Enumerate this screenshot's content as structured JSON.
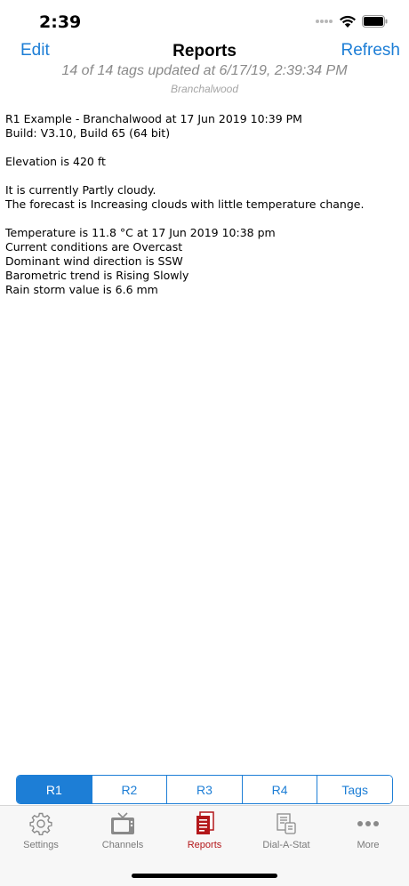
{
  "status_bar": {
    "time": "2:39"
  },
  "nav": {
    "edit_label": "Edit",
    "title": "Reports",
    "refresh_label": "Refresh",
    "subtitle": "14 of 14 tags updated at 6/17/19, 2:39:34 PM",
    "location": "Branchalwood"
  },
  "report": {
    "lines": [
      "R1 Example - Branchalwood at 17 Jun 2019 10:39 PM",
      "Build: V3.10, Build 65 (64 bit)",
      "",
      "Elevation is 420 ft",
      "",
      "It is currently Partly cloudy.",
      "The forecast is Increasing clouds with little temperature change.",
      "",
      "Temperature is 11.8 °C at 17 Jun 2019 10:38 pm",
      "Current conditions are Overcast",
      "Dominant wind direction is SSW",
      "Barometric trend is Rising Slowly",
      "Rain storm value is 6.6 mm"
    ]
  },
  "segments": {
    "items": [
      {
        "label": "R1",
        "selected": true
      },
      {
        "label": "R2",
        "selected": false
      },
      {
        "label": "R3",
        "selected": false
      },
      {
        "label": "R4",
        "selected": false
      },
      {
        "label": "Tags",
        "selected": false
      }
    ]
  },
  "tabs": {
    "items": [
      {
        "label": "Settings",
        "icon": "gear-icon",
        "selected": false
      },
      {
        "label": "Channels",
        "icon": "tv-icon",
        "selected": false
      },
      {
        "label": "Reports",
        "icon": "reports-icon",
        "selected": true
      },
      {
        "label": "Dial-A-Stat",
        "icon": "dial-a-stat-icon",
        "selected": false
      },
      {
        "label": "More",
        "icon": "more-icon",
        "selected": false
      }
    ]
  },
  "colors": {
    "accent": "#1d7ed6",
    "tab_active": "#b3171a",
    "tab_inactive": "#7a7a7a"
  }
}
